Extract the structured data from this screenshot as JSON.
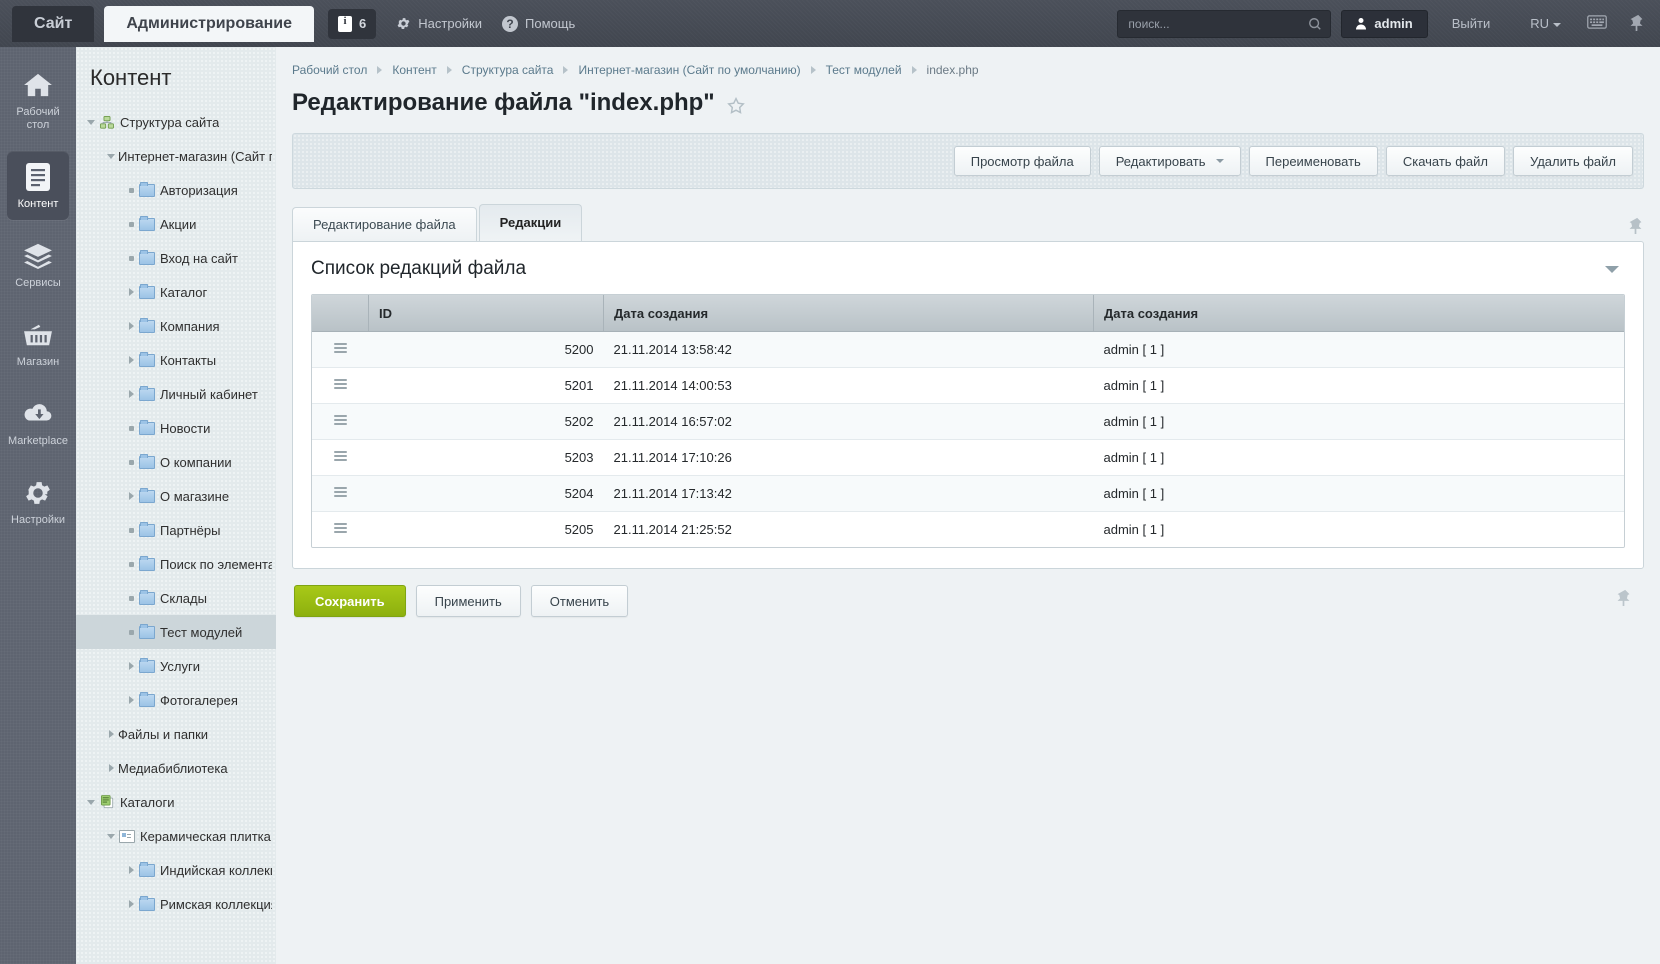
{
  "topbar": {
    "tabs": [
      {
        "label": "Сайт",
        "active": false
      },
      {
        "label": "Администрирование",
        "active": true
      }
    ],
    "notifications_count": "6",
    "settings_label": "Настройки",
    "help_label": "Помощь",
    "search_placeholder": "поиск...",
    "search_value": "",
    "user_label": "admin",
    "logout_label": "Выйти",
    "lang_label": "RU",
    "icons": [
      "info-icon",
      "gear-icon",
      "question-icon",
      "search-icon",
      "user-icon",
      "keyboard-icon",
      "pin-icon"
    ]
  },
  "rail": {
    "items": [
      {
        "label": "Рабочий стол",
        "icon": "home-icon",
        "active": false
      },
      {
        "label": "Контент",
        "icon": "document-icon",
        "active": true
      },
      {
        "label": "Сервисы",
        "icon": "layers-icon",
        "active": false
      },
      {
        "label": "Магазин",
        "icon": "basket-icon",
        "active": false
      },
      {
        "label": "Marketplace",
        "icon": "cloud-download-icon",
        "active": false
      },
      {
        "label": "Настройки",
        "icon": "gear-icon",
        "active": false
      }
    ]
  },
  "tree": {
    "title": "Контент",
    "nodes": [
      {
        "label": "Структура сайта",
        "indent": 0,
        "toggle": "down",
        "icon": "sitemap-icon",
        "selected": false
      },
      {
        "label": "Интернет-магазин (Сайт по умолчанию)",
        "indent": 1,
        "toggle": "down",
        "icon": "none",
        "selected": false
      },
      {
        "label": "Авторизация",
        "indent": 2,
        "toggle": "dot",
        "icon": "folder-icon",
        "selected": false
      },
      {
        "label": "Акции",
        "indent": 2,
        "toggle": "dot",
        "icon": "folder-icon",
        "selected": false
      },
      {
        "label": "Вход на сайт",
        "indent": 2,
        "toggle": "dot",
        "icon": "folder-icon",
        "selected": false
      },
      {
        "label": "Каталог",
        "indent": 2,
        "toggle": "right",
        "icon": "folder-icon",
        "selected": false
      },
      {
        "label": "Компания",
        "indent": 2,
        "toggle": "right",
        "icon": "folder-icon",
        "selected": false
      },
      {
        "label": "Контакты",
        "indent": 2,
        "toggle": "right",
        "icon": "folder-icon",
        "selected": false
      },
      {
        "label": "Личный кабинет",
        "indent": 2,
        "toggle": "right",
        "icon": "folder-icon",
        "selected": false
      },
      {
        "label": "Новости",
        "indent": 2,
        "toggle": "dot",
        "icon": "folder-icon",
        "selected": false
      },
      {
        "label": "О компании",
        "indent": 2,
        "toggle": "dot",
        "icon": "folder-icon",
        "selected": false
      },
      {
        "label": "О магазине",
        "indent": 2,
        "toggle": "right",
        "icon": "folder-icon",
        "selected": false
      },
      {
        "label": "Партнёры",
        "indent": 2,
        "toggle": "dot",
        "icon": "folder-icon",
        "selected": false
      },
      {
        "label": "Поиск по элементам",
        "indent": 2,
        "toggle": "dot",
        "icon": "folder-icon",
        "selected": false
      },
      {
        "label": "Склады",
        "indent": 2,
        "toggle": "dot",
        "icon": "folder-icon",
        "selected": false
      },
      {
        "label": "Тест модулей",
        "indent": 2,
        "toggle": "dot",
        "icon": "folder-icon",
        "selected": true
      },
      {
        "label": "Услуги",
        "indent": 2,
        "toggle": "right",
        "icon": "folder-icon",
        "selected": false
      },
      {
        "label": "Фотогалерея",
        "indent": 2,
        "toggle": "right",
        "icon": "folder-icon",
        "selected": false
      },
      {
        "label": "Файлы и папки",
        "indent": 1,
        "toggle": "right",
        "icon": "none",
        "selected": false
      },
      {
        "label": "Медиабиблиотека",
        "indent": 1,
        "toggle": "right",
        "icon": "none",
        "selected": false
      },
      {
        "label": "Каталоги",
        "indent": 0,
        "toggle": "down",
        "icon": "catalog-icon",
        "selected": false
      },
      {
        "label": "Керамическая плитка",
        "indent": 1,
        "toggle": "down",
        "icon": "infoblock-icon",
        "selected": false
      },
      {
        "label": "Индийская коллекция",
        "indent": 2,
        "toggle": "right",
        "icon": "folder-icon",
        "selected": false
      },
      {
        "label": "Римская коллекция",
        "indent": 2,
        "toggle": "right",
        "icon": "folder-icon",
        "selected": false
      }
    ]
  },
  "breadcrumb": [
    "Рабочий стол",
    "Контент",
    "Структура сайта",
    "Интернет-магазин (Сайт по умолчанию)",
    "Тест модулей",
    "index.php"
  ],
  "page": {
    "title": "Редактирование файла \"index.php\"",
    "favorite_icon": "star-icon"
  },
  "toolbar": {
    "buttons": [
      {
        "label": "Просмотр файла",
        "dropdown": false
      },
      {
        "label": "Редактировать",
        "dropdown": true
      },
      {
        "label": "Переименовать",
        "dropdown": false
      },
      {
        "label": "Скачать файл",
        "dropdown": false
      },
      {
        "label": "Удалить файл",
        "dropdown": false
      }
    ]
  },
  "tabs": [
    {
      "label": "Редактирование файла",
      "active": false
    },
    {
      "label": "Редакции",
      "active": true
    }
  ],
  "section": {
    "heading": "Список редакций файла",
    "collapse_icon": "chevron-down-icon"
  },
  "table": {
    "columns": [
      "",
      "ID",
      "Дата создания",
      "Дата создания"
    ],
    "rows": [
      {
        "id": "5200",
        "date": "21.11.2014 13:58:42",
        "user": "admin [ 1 ]"
      },
      {
        "id": "5201",
        "date": "21.11.2014 14:00:53",
        "user": "admin [ 1 ]"
      },
      {
        "id": "5202",
        "date": "21.11.2014 16:57:02",
        "user": "admin [ 1 ]"
      },
      {
        "id": "5203",
        "date": "21.11.2014 17:10:26",
        "user": "admin [ 1 ]"
      },
      {
        "id": "5204",
        "date": "21.11.2014 17:13:42",
        "user": "admin [ 1 ]"
      },
      {
        "id": "5205",
        "date": "21.11.2014 21:25:52",
        "user": "admin [ 1 ]"
      }
    ]
  },
  "footer": {
    "save_label": "Сохранить",
    "apply_label": "Применить",
    "cancel_label": "Отменить"
  },
  "colors": {
    "topbar": "#464b55",
    "rail": "#5e6470",
    "tree_bg": "#e3eaec",
    "tree_selected": "#ccd6da",
    "accent_green": "#9cc015",
    "content_bg": "#eef2f4",
    "grid_header": "#c3ccd1"
  }
}
